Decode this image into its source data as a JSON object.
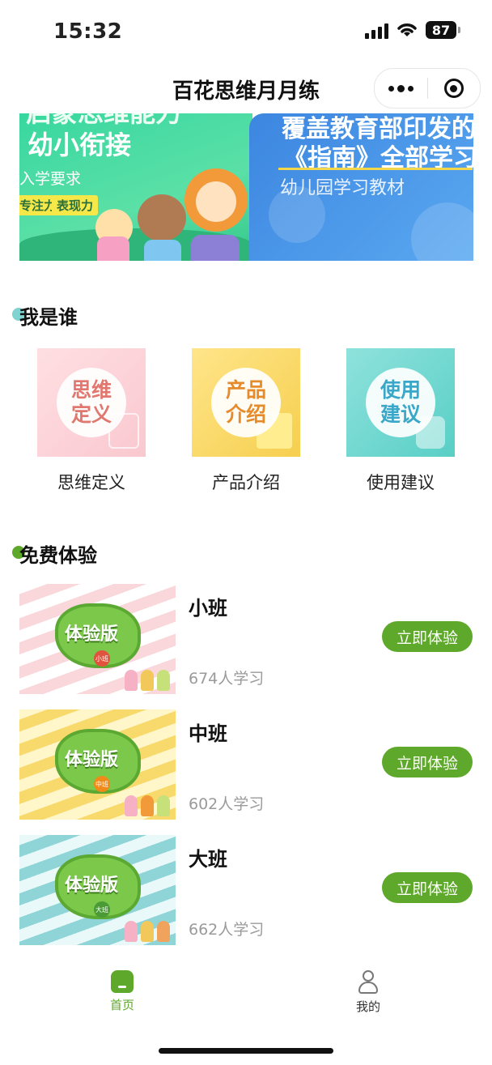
{
  "status": {
    "time": "15:32",
    "battery": "87"
  },
  "nav": {
    "title": "百花思维月月练"
  },
  "banner": {
    "slide1": {
      "headline_top": "启蒙思维能力",
      "headline": "幼小衔接",
      "sub": "入学要求",
      "tags": [
        "专注力",
        "表现力"
      ]
    },
    "slide2": {
      "headline_top": "覆盖教育部印发的",
      "headline": "《指南》全部学习",
      "sub": "幼儿园学习教材"
    }
  },
  "who": {
    "title": "我是谁",
    "cards": [
      {
        "thumb_text": "思维定义",
        "label": "思维定义"
      },
      {
        "thumb_text": "产品介绍",
        "label": "产品介绍"
      },
      {
        "thumb_text": "使用建议",
        "label": "使用建议"
      }
    ]
  },
  "free": {
    "title": "免费体验",
    "courses": [
      {
        "name": "小班",
        "count": "674人学习",
        "button": "立即体验",
        "badge": "小班",
        "cover_text": "体验版"
      },
      {
        "name": "中班",
        "count": "602人学习",
        "button": "立即体验",
        "badge": "中班",
        "cover_text": "体验版"
      },
      {
        "name": "大班",
        "count": "662人学习",
        "button": "立即体验",
        "badge": "大班",
        "cover_text": "体验版"
      }
    ]
  },
  "tabbar": {
    "home": "首页",
    "mine": "我的"
  },
  "colors": {
    "accent": "#5ea92b",
    "muted": "#9a9a9a"
  }
}
